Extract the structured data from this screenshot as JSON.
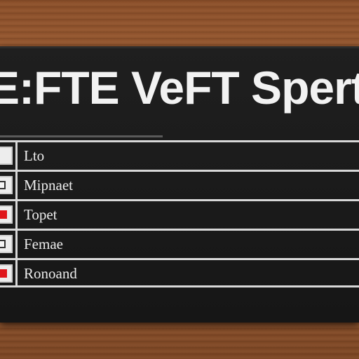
{
  "title": "E:FTE VeFT Spert",
  "rows": [
    {
      "label": "Lto",
      "checkbox": "empty"
    },
    {
      "label": "Mipnaet",
      "checkbox": "white"
    },
    {
      "label": "Topet",
      "checkbox": "red"
    },
    {
      "label": "Femae",
      "checkbox": "white"
    },
    {
      "label": "Ronoand",
      "checkbox": "red"
    }
  ],
  "colors": {
    "panel": "#1a1a1a",
    "text": "#f2f2f2",
    "accent_red": "#e0161b",
    "lines": "#d8d8d8",
    "wood": "#a4643a"
  }
}
